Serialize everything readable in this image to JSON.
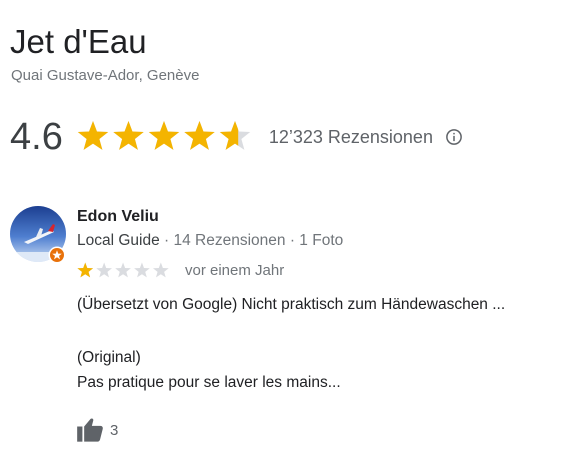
{
  "place": {
    "title": "Jet d'Eau",
    "address": "Quai Gustave-Ador, Genève"
  },
  "rating": {
    "value": "4.6",
    "score": 4.6,
    "max": 5,
    "reviews_label": "12’323 Rezensionen",
    "icon": "info-icon"
  },
  "review": {
    "reviewer_name": "Edon Veliu",
    "reviewer_type": "Local Guide",
    "reviewer_stats": " · 14 Rezensionen · 1 Foto",
    "stars": 1,
    "date": "vor einem Jahr",
    "text": "(Übersetzt von Google) Nicht praktisch zum Händewaschen ...",
    "original_label": "(Original)",
    "original_text": "Pas pratique pour se laver les mains...",
    "likes": "3",
    "like_icon": "thumbs-up-icon"
  },
  "colors": {
    "star_filled": "#f4b400",
    "star_empty": "#dadce0",
    "guide_badge": "#e8710a"
  }
}
